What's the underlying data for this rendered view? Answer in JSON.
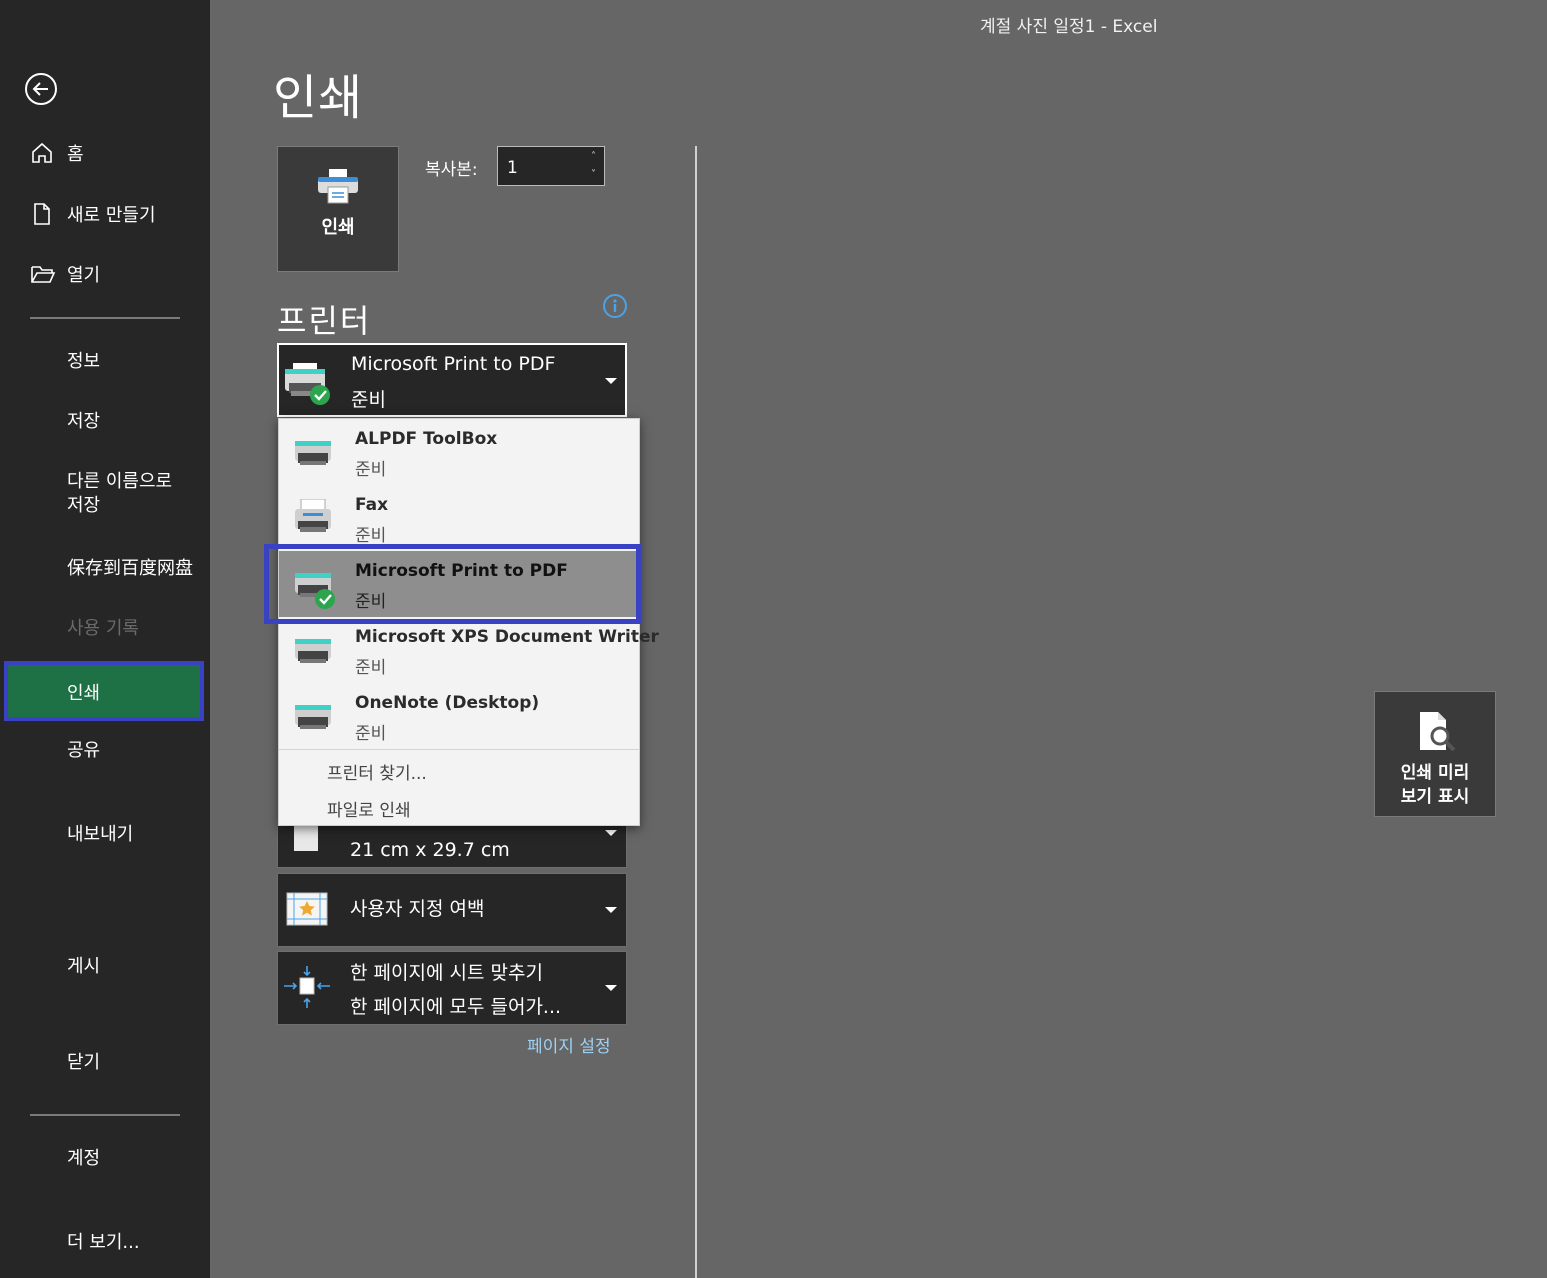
{
  "window": {
    "title": "계절 사진 일정1  -  Excel"
  },
  "sidebar": {
    "back_icon": "back-arrow-circle-icon",
    "items": [
      {
        "label": "홈",
        "icon": "home-icon"
      },
      {
        "label": "새로 만들기",
        "icon": "new-document-icon"
      },
      {
        "label": "열기",
        "icon": "open-folder-icon"
      },
      {
        "label": "정보"
      },
      {
        "label": "저장"
      },
      {
        "label_line1": "다른 이름으로",
        "label_line2": "저장"
      },
      {
        "label": "保存到百度网盘"
      },
      {
        "label": "사용 기록",
        "disabled": true
      },
      {
        "label": "인쇄",
        "active": true
      },
      {
        "label": "공유"
      },
      {
        "label": "내보내기"
      },
      {
        "label": "게시"
      },
      {
        "label": "닫기"
      },
      {
        "label": "계정"
      },
      {
        "label": "더 보기..."
      }
    ],
    "active_color": "#1e7145",
    "highlight_color": "#3a42c4"
  },
  "main": {
    "title": "인쇄",
    "print_button": {
      "label": "인쇄",
      "icon": "printer-icon"
    },
    "copies": {
      "label": "복사본:",
      "value": "1"
    },
    "printer_section": {
      "title": "프린터",
      "info_icon": "info-icon"
    },
    "selected_printer": {
      "name": "Microsoft Print to PDF",
      "status": "준비"
    },
    "paper": {
      "size": "21 cm x 29.7 cm"
    },
    "margins": {
      "label": "사용자 지정 여백"
    },
    "scaling": {
      "line1": "한 페이지에 시트 맞추기",
      "line2": "한 페이지에 모두 들어가..."
    },
    "page_setup_link": "페이지 설정",
    "preview_button": {
      "line1": "인쇄 미리",
      "line2": "보기 표시",
      "icon": "print-preview-icon"
    }
  },
  "printer_dropdown": {
    "items": [
      {
        "name": "ALPDF ToolBox",
        "status": "준비"
      },
      {
        "name": "Fax",
        "status": "준비"
      },
      {
        "name": "Microsoft Print to PDF",
        "status": "준비",
        "selected": true
      },
      {
        "name": "Microsoft XPS Document Writer",
        "status": "준비"
      },
      {
        "name": "OneNote (Desktop)",
        "status": "준비"
      }
    ],
    "find_printer": "프린터 찾기...",
    "print_to_file": "파일로 인쇄"
  }
}
